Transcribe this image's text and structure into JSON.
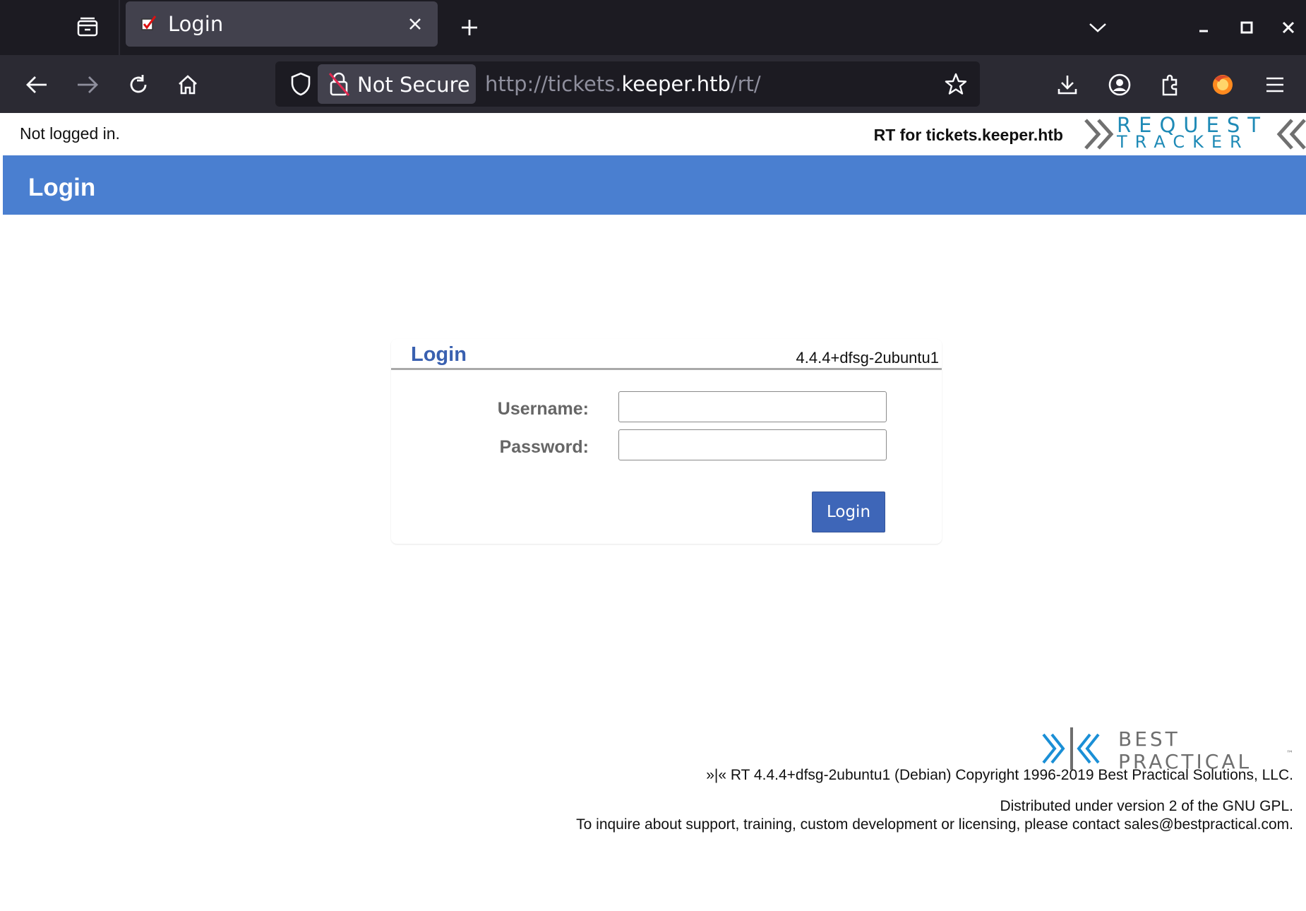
{
  "browser": {
    "tab_title": "Login",
    "url_scheme": "http://tickets.",
    "url_host": "keeper.htb",
    "url_path": "/rt/",
    "security_label": "Not Secure"
  },
  "page": {
    "login_status": "Not logged in.",
    "site_name": "RT for tickets.keeper.htb",
    "rt_logo": {
      "line1": "REQUEST",
      "line2": "TRACKER"
    },
    "header_title": "Login"
  },
  "login_box": {
    "title": "Login",
    "version": "4.4.4+dfsg-2ubuntu1",
    "username_label": "Username:",
    "password_label": "Password:",
    "username_value": "",
    "password_value": "",
    "submit_label": "Login"
  },
  "footer": {
    "bp_logo": {
      "line1": "BEST",
      "line2": "PRACTICAL",
      "tm": "™"
    },
    "copyright": "»|« RT 4.4.4+dfsg-2ubuntu1 (Debian) Copyright 1996-2019 Best Practical Solutions, LLC.",
    "license": "Distributed under version 2 of the GNU GPL.",
    "contact": "To inquire about support, training, custom development or licensing, please contact sales@bestpractical.com."
  },
  "colors": {
    "header_bg": "#4a7fd0",
    "button_bg": "#3e66b8",
    "title_blue": "#3960b0",
    "rt_logo_blue": "#1e8ab6",
    "bp_logo_blue": "#1a8fd6"
  },
  "icons": [
    "tab-list-icon",
    "favicon-icon",
    "close-tab-icon",
    "new-tab-icon",
    "chevron-down-icon",
    "minimize-icon",
    "maximize-icon",
    "close-window-icon",
    "back-arrow-icon",
    "forward-arrow-icon",
    "reload-icon",
    "home-icon",
    "shield-icon",
    "insecure-lock-icon",
    "star-icon",
    "download-icon",
    "account-icon",
    "extensions-icon",
    "firefox-icon",
    "menu-icon"
  ]
}
